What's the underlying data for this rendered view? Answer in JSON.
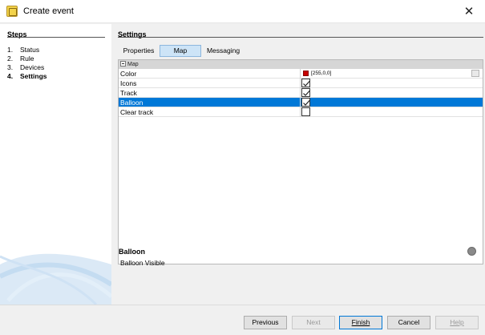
{
  "window": {
    "title": "Create event"
  },
  "steps": {
    "title": "Steps",
    "items": [
      {
        "num": "1.",
        "label": "Status"
      },
      {
        "num": "2.",
        "label": "Rule"
      },
      {
        "num": "3.",
        "label": "Devices"
      },
      {
        "num": "4.",
        "label": "Settings"
      }
    ],
    "active_index": 3
  },
  "settings": {
    "title": "Settings",
    "tabs": [
      {
        "label": "Properties"
      },
      {
        "label": "Map"
      },
      {
        "label": "Messaging"
      }
    ],
    "selected_tab": "Map",
    "grid": {
      "group": "Map",
      "rows": [
        {
          "name": "Color",
          "type": "color",
          "value": "[255,0,0]",
          "swatch": "#c80000"
        },
        {
          "name": "Icons",
          "type": "checkbox",
          "checked": true
        },
        {
          "name": "Track",
          "type": "checkbox",
          "checked": true
        },
        {
          "name": "Balloon",
          "type": "checkbox",
          "checked": true,
          "selected": true
        },
        {
          "name": "Clear track",
          "type": "checkbox",
          "checked": false
        }
      ]
    },
    "description": {
      "title": "Balloon",
      "text": "Balloon Visible"
    }
  },
  "footer": {
    "previous": "Previous",
    "next": "Next",
    "finish": "Finish",
    "cancel": "Cancel",
    "help": "Help"
  },
  "colors": {
    "selection": "#0078d7",
    "tab_selected": "#cde4f7",
    "swatch_red": "#c80000"
  }
}
